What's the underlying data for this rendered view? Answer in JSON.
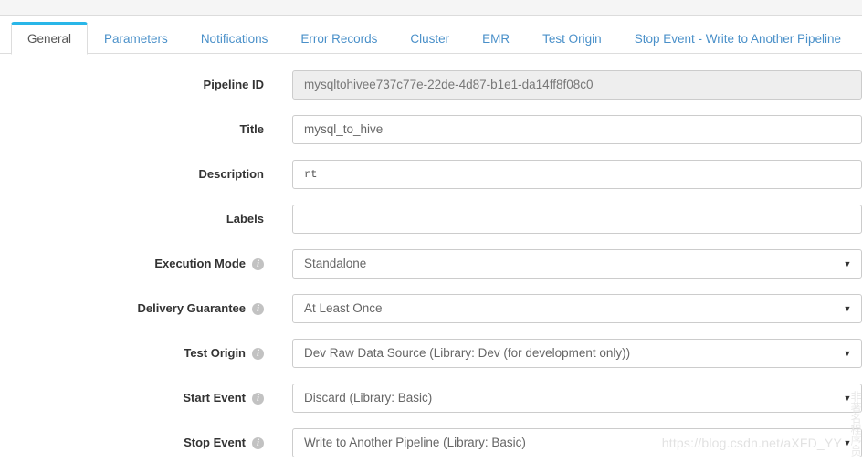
{
  "tabs": [
    {
      "label": "General",
      "active": true
    },
    {
      "label": "Parameters",
      "active": false
    },
    {
      "label": "Notifications",
      "active": false
    },
    {
      "label": "Error Records",
      "active": false
    },
    {
      "label": "Cluster",
      "active": false
    },
    {
      "label": "EMR",
      "active": false
    },
    {
      "label": "Test Origin",
      "active": false
    },
    {
      "label": "Stop Event - Write to Another Pipeline",
      "active": false
    }
  ],
  "form": {
    "rows": [
      {
        "label": "Pipeline ID",
        "value": "mysqltohivee737c77e-22de-4d87-b1e1-da14ff8f08c0",
        "type": "text",
        "disabled": true,
        "info": false,
        "name": "pipeline-id"
      },
      {
        "label": "Title",
        "value": "mysql_to_hive",
        "type": "text",
        "disabled": false,
        "info": false,
        "name": "title"
      },
      {
        "label": "Description",
        "value": "rt",
        "type": "textarea",
        "disabled": false,
        "info": false,
        "name": "description"
      },
      {
        "label": "Labels",
        "value": "",
        "type": "text",
        "disabled": false,
        "info": false,
        "name": "labels"
      },
      {
        "label": "Execution Mode",
        "value": "Standalone",
        "type": "select",
        "disabled": false,
        "info": true,
        "name": "execution-mode"
      },
      {
        "label": "Delivery Guarantee",
        "value": "At Least Once",
        "type": "select",
        "disabled": false,
        "info": true,
        "name": "delivery-guarantee"
      },
      {
        "label": "Test Origin",
        "value": "Dev Raw Data Source (Library: Dev (for development only))",
        "type": "select",
        "disabled": false,
        "info": true,
        "name": "test-origin"
      },
      {
        "label": "Start Event",
        "value": "Discard (Library: Basic)",
        "type": "select",
        "disabled": false,
        "info": true,
        "name": "start-event"
      },
      {
        "label": "Stop Event",
        "value": "Write to Another Pipeline (Library: Basic)",
        "type": "select",
        "disabled": false,
        "info": true,
        "name": "stop-event"
      }
    ]
  },
  "icons": {
    "info": "i",
    "caret_down": "▼"
  },
  "watermark": {
    "url": "https://blog.csdn.net/aXFD_YY",
    "cn": "非著名程序员"
  },
  "colors": {
    "active_tab_top": "#29b6e8",
    "tab_link": "#4a90c9",
    "field_border": "#cccccc",
    "disabled_bg": "#eeeeee"
  }
}
